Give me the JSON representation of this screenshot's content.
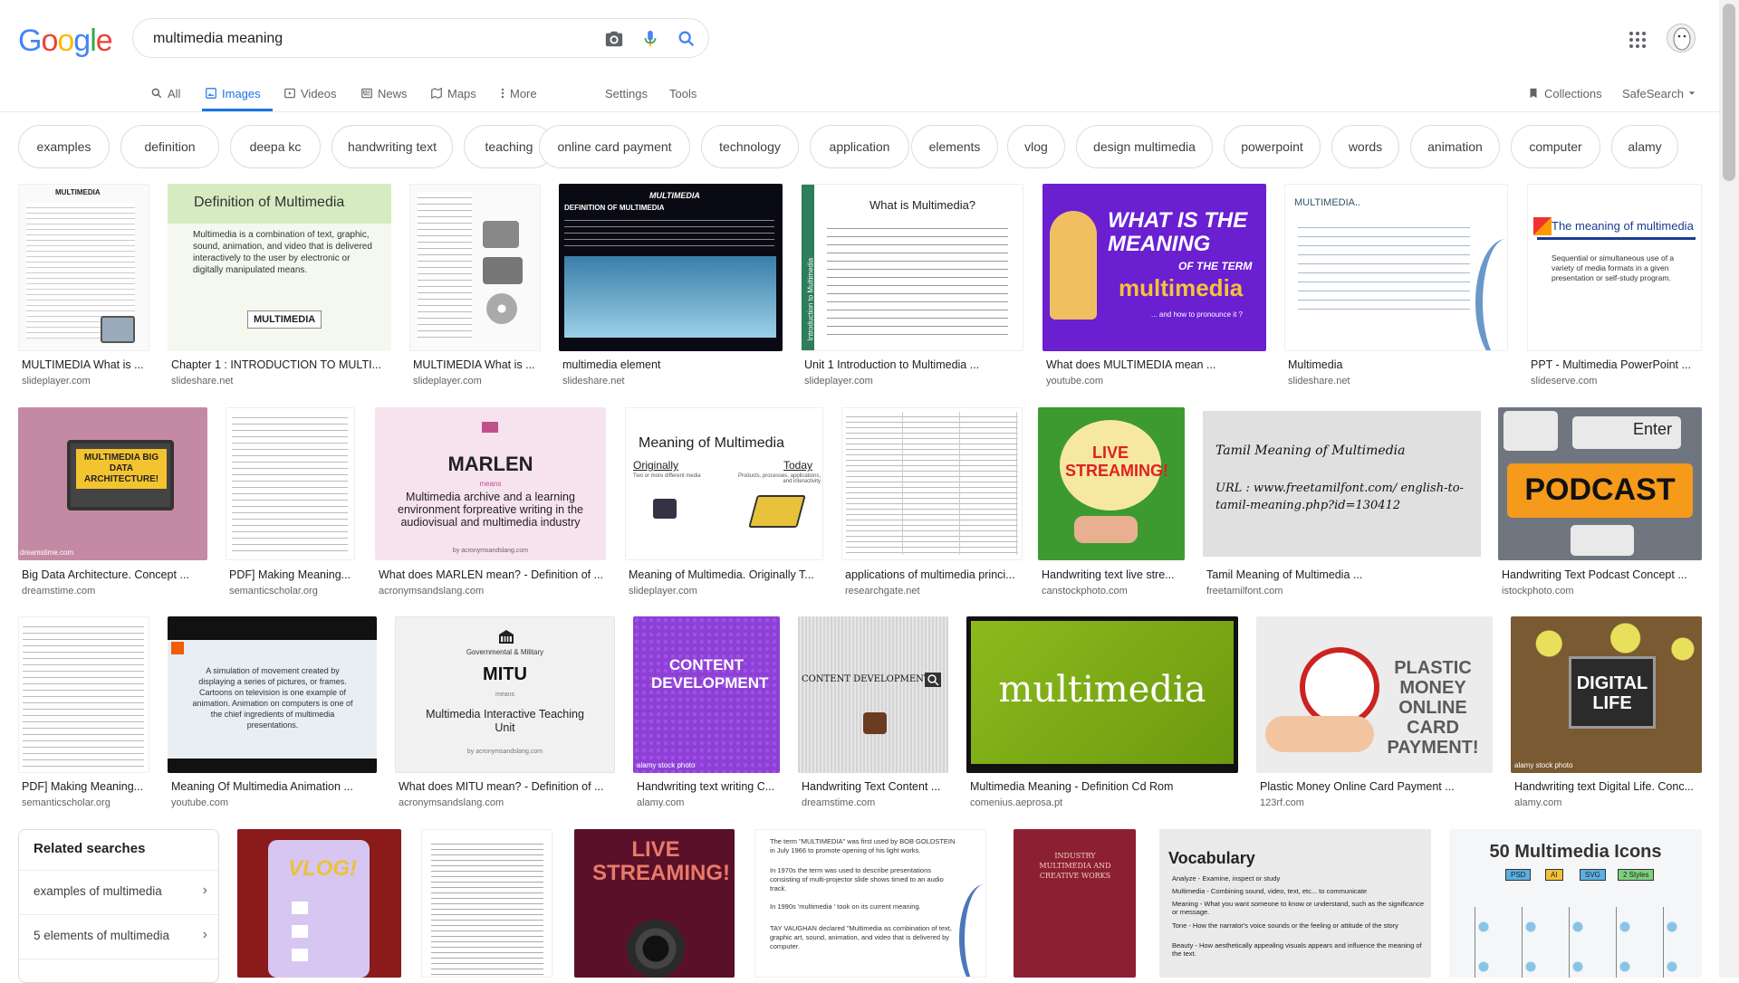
{
  "logo": {
    "text": "Google",
    "letters": [
      "G",
      "o",
      "o",
      "g",
      "l",
      "e"
    ],
    "colors": [
      "#4285f4",
      "#ea4335",
      "#fbbc05",
      "#4285f4",
      "#34a853",
      "#ea4335"
    ]
  },
  "search": {
    "query": "multimedia meaning"
  },
  "nav": {
    "tabs": [
      "All",
      "Images",
      "Videos",
      "News",
      "Maps",
      "More"
    ],
    "settings": "Settings",
    "tools": "Tools",
    "collections": "Collections",
    "safesearch": "SafeSearch"
  },
  "chips": [
    "examples",
    "definition",
    "deepa kc",
    "handwriting text",
    "teaching",
    "online card payment",
    "technology",
    "application",
    "elements",
    "vlog",
    "design multimedia",
    "powerpoint",
    "words",
    "animation",
    "computer",
    "alamy"
  ],
  "row1": [
    {
      "caption": "MULTIMEDIA What is ...",
      "source": "slideplayer.com",
      "text": "MULTIMEDIA"
    },
    {
      "caption": "Chapter 1 : INTRODUCTION TO MULTI...",
      "source": "slideshare.net",
      "text": "Definition of Multimedia",
      "sub": "Multimedia is a combination of text, graphic, sound, animation, and video that is delivered interactively to the user by electronic or digitally manipulated means.",
      "box": "MULTIMEDIA"
    },
    {
      "caption": "MULTIMEDIA What is ...",
      "source": "slideplayer.com",
      "text": ""
    },
    {
      "caption": "multimedia element",
      "source": "slideshare.net",
      "text": "MULTIMEDIA",
      "sub": "DEFINITION OF MULTIMEDIA"
    },
    {
      "caption": "Unit 1 Introduction to Multimedia ...",
      "source": "slideplayer.com",
      "text": "What is Multimedia?",
      "side": "Introduction to Multimedia"
    },
    {
      "caption": "What does MULTIMEDIA mean ...",
      "source": "youtube.com",
      "text": "WHAT IS THE MEANING",
      "sub": "OF THE TERM",
      "big": "multimedia",
      "foot": "... and how to pronounce it ?"
    },
    {
      "caption": "Multimedia",
      "source": "slideshare.net",
      "text": "MULTIMEDIA.."
    },
    {
      "caption": "PPT - Multimedia PowerPoint ...",
      "source": "slideserve.com",
      "text": "The meaning of multimedia",
      "sub": "Sequential or simultaneous use of a variety of media formats in a given presentation or self-study program."
    }
  ],
  "row2": [
    {
      "caption": "Big Data Architecture. Concept ...",
      "source": "dreamstime.com",
      "text": "MULTIMEDIA BIG DATA ARCHITECTURE!",
      "wm": "dreamstime.com"
    },
    {
      "caption": "PDF] Making Meaning...",
      "source": "semanticscholar.org",
      "text": ""
    },
    {
      "caption": "What does MARLEN mean? - Definition of ...",
      "source": "acronymsandslang.com",
      "text": "MARLEN",
      "sub": "means",
      "big": "Multimedia archive and a learning environment forpreative writing in the audiovisual and multimedia industry",
      "foot": "by acronymsandslang.com"
    },
    {
      "caption": "Meaning of Multimedia. Originally T...",
      "source": "slideplayer.com",
      "text": "Meaning of Multimedia",
      "left": "Originally",
      "right": "Today",
      "sub": "Two or more different media",
      "sub2": "Products, processes, applications, and interactivity"
    },
    {
      "caption": "applications of multimedia princi...",
      "source": "researchgate.net",
      "text": ""
    },
    {
      "caption": "Handwriting text live stre...",
      "source": "canstockphoto.com",
      "text": "LIVE STREAMING!"
    },
    {
      "caption": "Tamil Meaning of Multimedia ...",
      "source": "freetamilfont.com",
      "text": "Tamil Meaning of Multimedia",
      "sub": "URL : www.freetamilfont.com/ english-to-tamil-meaning.php?id=130412"
    },
    {
      "caption": "Handwriting Text Podcast Concept ...",
      "source": "istockphoto.com",
      "text": "PODCAST",
      "sub": "Enter"
    }
  ],
  "row3": [
    {
      "caption": "PDF] Making Meaning...",
      "source": "semanticscholar.org",
      "text": ""
    },
    {
      "caption": "Meaning Of Multimedia Animation ...",
      "source": "youtube.com",
      "text": "A simulation of movement created by displaying a series of pictures, or frames. Cartoons on television is one example of animation. Animation on computers is one of the chief ingredients of multimedia presentations."
    },
    {
      "caption": "What does MITU mean? - Definition of ...",
      "source": "acronymsandslang.com",
      "text": "MITU",
      "sub": "Governmental & Military",
      "small": "means",
      "big": "Multimedia Interactive Teaching Unit",
      "foot": "by acronymsandslang.com"
    },
    {
      "caption": "Handwriting text writing C...",
      "source": "alamy.com",
      "text": "CONTENT DEVELOPMENT",
      "wm": "alamy stock photo"
    },
    {
      "caption": "Handwriting Text Content ...",
      "source": "dreamstime.com",
      "text": "CONTENT DEVELOPMENT"
    },
    {
      "caption": "Multimedia Meaning - Definition Cd Rom",
      "source": "comenius.aeprosa.pt",
      "text": "multimedia"
    },
    {
      "caption": "Plastic Money Online Card Payment ...",
      "source": "123rf.com",
      "text": "PLASTIC MONEY ONLINE CARD PAYMENT!"
    },
    {
      "caption": "Handwriting text Digital Life. Conc...",
      "source": "alamy.com",
      "text": "DIGITAL LIFE",
      "wm": "alamy stock photo"
    }
  ],
  "related": {
    "title": "Related searches",
    "items": [
      "examples of multimedia",
      "5 elements of multimedia"
    ]
  },
  "row4": [
    {
      "text": "VLOG!"
    },
    {
      "text": ""
    },
    {
      "text": "LIVE STREAMING!"
    },
    {
      "text": "The term \"MULTIMEDIA\" was first used by BOB GOLDSTEIN in July 1966 to promote opening of his light works.",
      "sub": "In 1970s the term was used to describe presentations consisting of multi-projector slide shows timed to an audio track.",
      "sub2": "In 1990s 'multimedia ' took on its current meaning.",
      "foot": "TAY VAUGHAN declared \"Multimedia as combination of text, graphic art, sound, animation, and video that is delivered by computer."
    },
    {
      "text": "INDUSTRY MULTIMEDIA AND CREATIVE WORKS"
    },
    {
      "text": "Vocabulary",
      "items": [
        "Analyze - Examine, inspect or study",
        "Multimedia - Combining sound, video, text, etc... to communicate",
        "Meaning - What you want someone to know or understand, such as the significance or message.",
        "Tone - How the narrator's voice sounds or the feeling or attitude of the story",
        "Beauty - How aesthetically appealing visuals appears and influence the meaning of the text."
      ]
    },
    {
      "text": "50 Multimedia Icons",
      "tags": [
        "PSD",
        "AI",
        "SVG",
        "2 Styles"
      ]
    }
  ]
}
